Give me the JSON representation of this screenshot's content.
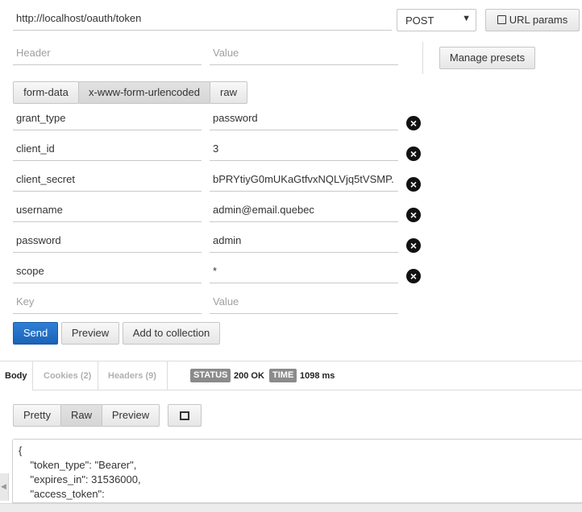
{
  "request": {
    "url": "http://localhost/oauth/token",
    "method": "POST",
    "url_params_label": "URL params",
    "header_placeholder": "Header",
    "value_placeholder": "Value",
    "manage_presets_label": "Manage presets"
  },
  "body_tabs": [
    "form-data",
    "x-www-form-urlencoded",
    "raw"
  ],
  "params": [
    {
      "key": "grant_type",
      "value": "password"
    },
    {
      "key": "client_id",
      "value": "3"
    },
    {
      "key": "client_secret",
      "value": "bPRYtiyG0mUKaGtfvxNQLVjq5tVSMP."
    },
    {
      "key": "username",
      "value": "admin@email.quebec"
    },
    {
      "key": "password",
      "value": "admin"
    },
    {
      "key": "scope",
      "value": "*"
    }
  ],
  "new_param": {
    "key_placeholder": "Key",
    "value_placeholder": "Value"
  },
  "actions": {
    "send": "Send",
    "preview": "Preview",
    "add_to_collection": "Add to collection"
  },
  "response": {
    "tabs": {
      "body": "Body",
      "cookies": "Cookies (2)",
      "headers": "Headers (9)"
    },
    "status_label": "STATUS",
    "status_value": "200 OK",
    "time_label": "TIME",
    "time_value": "1098 ms",
    "view_buttons": [
      "Pretty",
      "Raw",
      "Preview"
    ],
    "json_lines": [
      "{",
      "    \"token_type\": \"Bearer\",",
      "    \"expires_in\": 31536000,",
      "    \"access_token\":"
    ]
  },
  "colors": {
    "send_button": "#1a63b8",
    "badge": "#8b8b8b"
  },
  "icons": {
    "url_params": "edit-icon",
    "remove": "remove-circle-icon",
    "fullscreen": "fullscreen-icon",
    "collapse": "caret-left-icon"
  }
}
